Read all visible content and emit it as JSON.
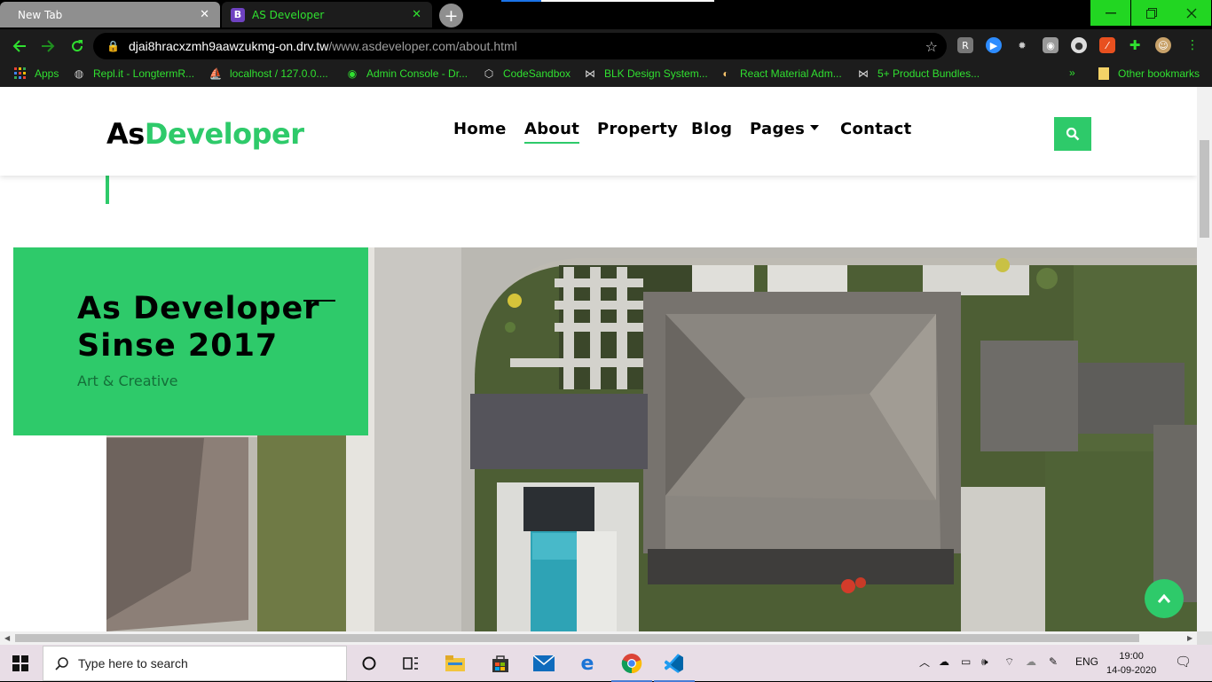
{
  "browser": {
    "tabs": [
      {
        "label": "New Tab",
        "active": false
      },
      {
        "label": "AS Developer",
        "active": true,
        "favicon": "B"
      }
    ],
    "address": {
      "host": "djai8hracxzmh9aawzukmg-on.drv.tw",
      "path": "/www.asdeveloper.com/about.html"
    },
    "bookmarks": [
      {
        "label": "Apps",
        "icon": "apps-grid-icon"
      },
      {
        "label": "Repl.it - LongtermR...",
        "icon": "replit-icon"
      },
      {
        "label": "localhost / 127.0.0....",
        "icon": "phpmyadmin-icon"
      },
      {
        "label": "Admin Console - Dr...",
        "icon": "globe-icon"
      },
      {
        "label": "CodeSandbox",
        "icon": "codesandbox-icon"
      },
      {
        "label": "BLK Design System...",
        "icon": "blk-icon"
      },
      {
        "label": "React Material Adm...",
        "icon": "react-material-icon"
      },
      {
        "label": "5+ Product Bundles...",
        "icon": "bundle-icon"
      }
    ],
    "other_bookmarks": "Other bookmarks",
    "overflow": "»"
  },
  "site": {
    "logo_prefix": "As",
    "logo_suffix": "Developer",
    "nav": [
      {
        "label": "Home"
      },
      {
        "label": "About",
        "active": true
      },
      {
        "label": "Property"
      },
      {
        "label": "Blog"
      },
      {
        "label": "Pages",
        "dropdown": true
      },
      {
        "label": "Contact"
      }
    ],
    "hero": {
      "title_line1": "As Developer",
      "title_line2": "Sinse 2017",
      "subtitle": "Art & Creative"
    },
    "accent": "#2eca6a"
  },
  "taskbar": {
    "search_placeholder": "Type here to search",
    "language": "ENG",
    "time": "19:00",
    "date": "14-09-2020"
  }
}
